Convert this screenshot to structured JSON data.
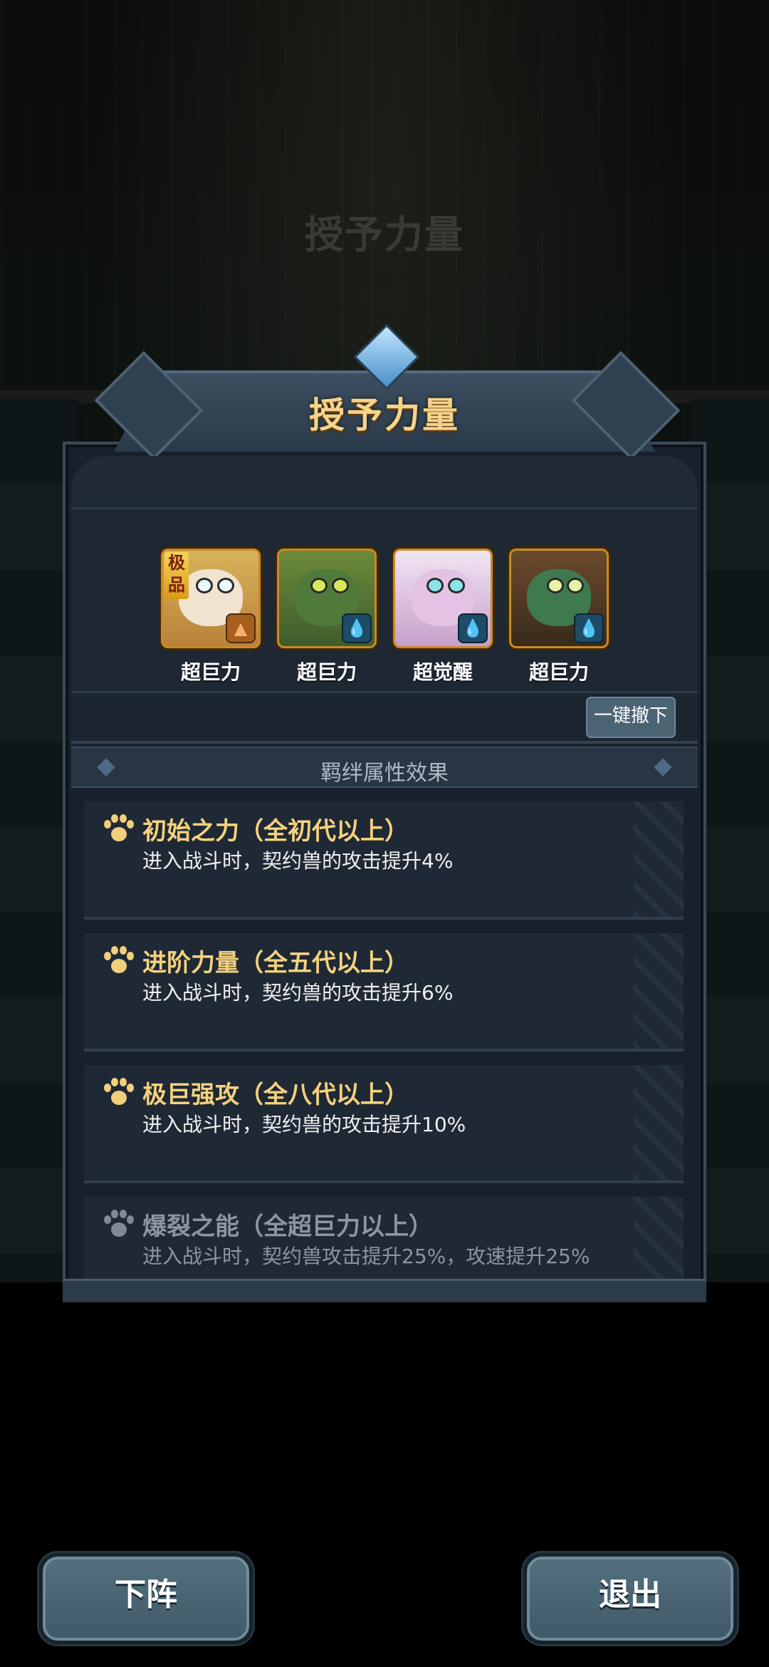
{
  "screen": {
    "background_title": "授予力量",
    "title": "授予力量"
  },
  "pets": [
    {
      "label": "超巨力",
      "rare_tag": "极品",
      "element_icon": "earth-icon",
      "colors": {
        "body": "#f0e3cf",
        "accent": "#c8623e"
      }
    },
    {
      "label": "超巨力",
      "rare_tag": "",
      "element_icon": "water-drop-icon",
      "colors": {
        "body": "#4f7a3a",
        "accent": "#c9a44c"
      }
    },
    {
      "label": "超觉醒",
      "rare_tag": "",
      "element_icon": "water-drop-icon",
      "colors": {
        "body": "#e3c2e3",
        "accent": "#9b4b8e"
      }
    },
    {
      "label": "超巨力",
      "rare_tag": "",
      "element_icon": "water-drop-icon",
      "colors": {
        "body": "#3f7a4f",
        "accent": "#d98a2a"
      }
    }
  ],
  "remove_all_label": "一键撤下",
  "section_title": "羁绊属性效果",
  "bonds": [
    {
      "title": "初始之力（全初代以上）",
      "desc": "进入战斗时，契约兽的攻击提升4%",
      "active": true
    },
    {
      "title": "进阶力量（全五代以上）",
      "desc": "进入战斗时，契约兽的攻击提升6%",
      "active": true
    },
    {
      "title": "极巨强攻（全八代以上）",
      "desc": "进入战斗时，契约兽的攻击提升10%",
      "active": true
    },
    {
      "title": "爆裂之能（全超巨力以上）",
      "desc": "进入战斗时，契约兽攻击提升25%，攻速提升25%",
      "active": false
    }
  ],
  "buttons": {
    "dismiss_label": "下阵",
    "exit_label": "退出"
  },
  "colors": {
    "title_gold": "#f6d38a",
    "frame_gold": "#c98a26",
    "panel_bg": "#18212b"
  }
}
